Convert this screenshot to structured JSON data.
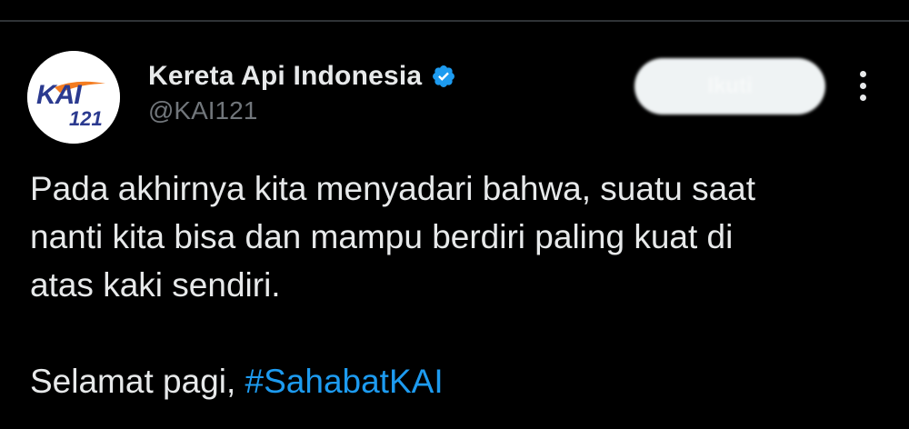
{
  "account": {
    "display_name": "Kereta Api Indonesia",
    "handle": "@KAI121",
    "verified": true,
    "avatar": {
      "logo_text": "KAI",
      "logo_number": "121",
      "colors": {
        "background": "#ffffff",
        "navy": "#2b3a8f",
        "orange": "#f47c20"
      }
    }
  },
  "actions": {
    "follow_label": "Ikuti",
    "more_icon": "more-vertical-icon"
  },
  "tweet": {
    "lines": [
      "Pada akhirnya kita menyadari bahwa, suatu saat",
      "nanti kita bisa dan mampu berdiri paling kuat di",
      "atas kaki sendiri."
    ],
    "greeting": "Selamat pagi, ",
    "hashtag": "#SahabatKAI"
  },
  "colors": {
    "background": "#000000",
    "text": "#e7e9ea",
    "secondary_text": "#71767b",
    "link": "#1d9bf0",
    "verified": "#1d9bf0",
    "divider": "#2f3336"
  }
}
